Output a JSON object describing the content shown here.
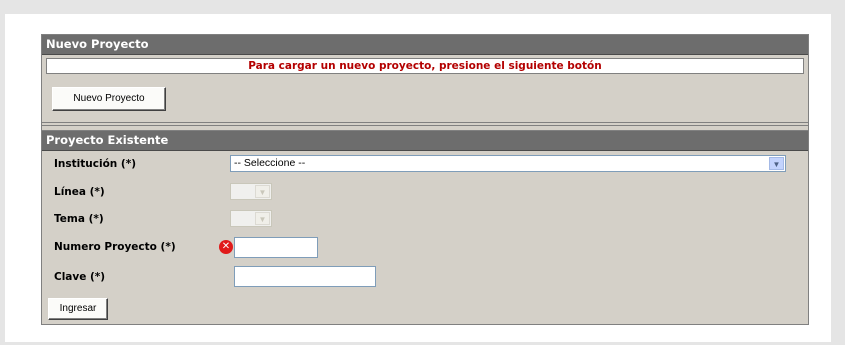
{
  "new_project": {
    "header": "Nuevo Proyecto",
    "message": "Para cargar un nuevo proyecto, presione el siguiente botón",
    "button": "Nuevo Proyecto"
  },
  "existing_project": {
    "header": "Proyecto Existente",
    "fields": {
      "institucion_label": "Institución (*)",
      "institucion_value": "-- Seleccione --",
      "linea_label": "Línea (*)",
      "tema_label": "Tema (*)",
      "numero_label": "Numero Proyecto (*)",
      "clave_label": "Clave (*)"
    },
    "button": "Ingresar"
  },
  "icons": {
    "dropdown": "chevron-down-icon",
    "validation_error": "error-icon"
  },
  "colors": {
    "header_bg": "#6d6d6d",
    "panel_bg": "#d4d0c8",
    "message_text": "#b30000",
    "error_icon": "#e01a1a"
  }
}
